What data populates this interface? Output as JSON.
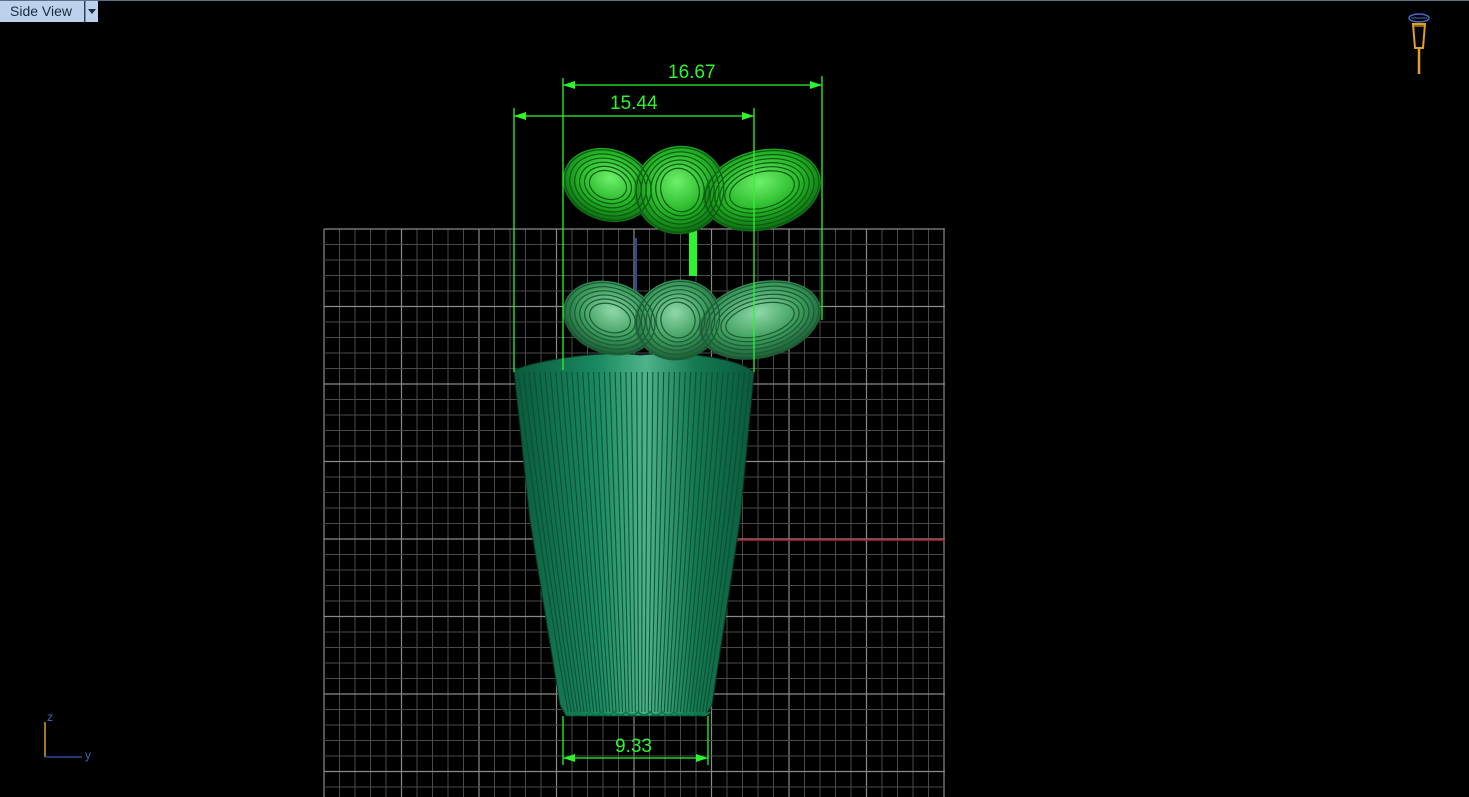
{
  "viewport": {
    "name": "Side View",
    "menu_icon": "chevron-down-icon"
  },
  "dimensions": {
    "top_width": "16.67",
    "middle_width": "15.44",
    "base_width": "9.33"
  },
  "axis_gizmo": {
    "vertical": "z",
    "horizontal": "y"
  },
  "colors": {
    "background": "#000000",
    "grid": "#5a5a5a",
    "dimension": "#2df52d",
    "axis_x": "#c0182a",
    "axis_z": "#2a4a9a",
    "body_green": "#0f7a52",
    "ribbon_bright": "#29c62a",
    "ribbon_mid": "#3a9a5a"
  },
  "light_icon": "spotlight-icon"
}
